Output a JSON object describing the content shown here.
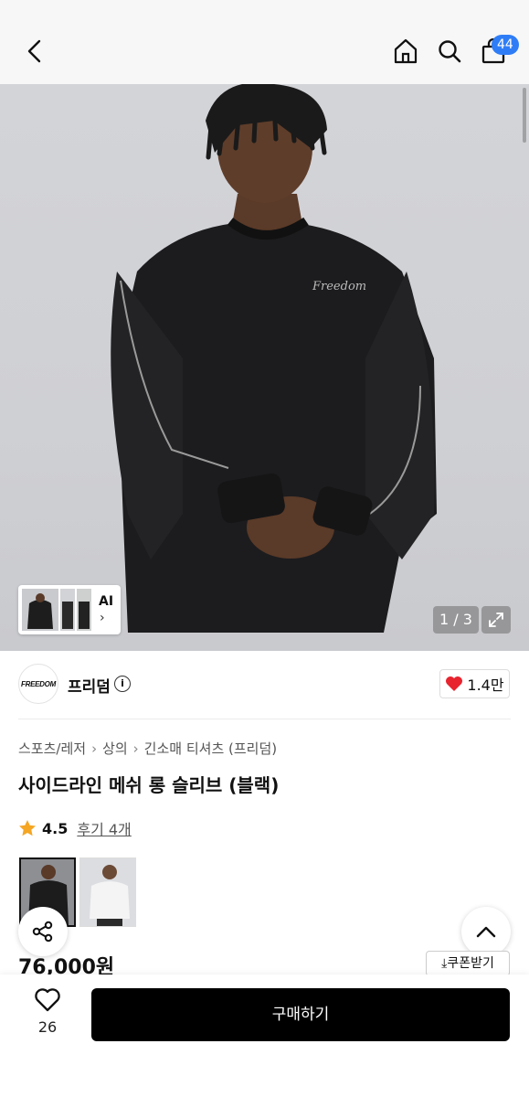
{
  "header": {
    "cart_count": "44",
    "icons": [
      "chevron-left-icon",
      "home-icon",
      "search-icon",
      "shopping-bag-icon"
    ]
  },
  "gallery": {
    "ai_label": "AI",
    "ai_chevron": "›",
    "counter": "1 / 3"
  },
  "brand": {
    "logo_text": "FREEDOM",
    "name": "프리덤",
    "info_symbol": "i",
    "likes": "1.4만"
  },
  "breadcrumb": {
    "items": [
      "스포츠/레저",
      "상의",
      "긴소매 티셔츠 (프리덤)"
    ],
    "separator": "›"
  },
  "product": {
    "title": "사이드라인 메쉬 롱 슬리브 (블랙)",
    "rating": "4.5",
    "reviews": "후기 4개",
    "price": "76,000원",
    "coupon_label": "쿠폰받기"
  },
  "colors": {
    "accent_blue": "#2f7df6",
    "heart_red": "#e8242f",
    "star_orange": "#f5a623",
    "buy_button": "#000000"
  },
  "bottom_bar": {
    "wish_count": "26",
    "buy_label": "구매하기"
  }
}
